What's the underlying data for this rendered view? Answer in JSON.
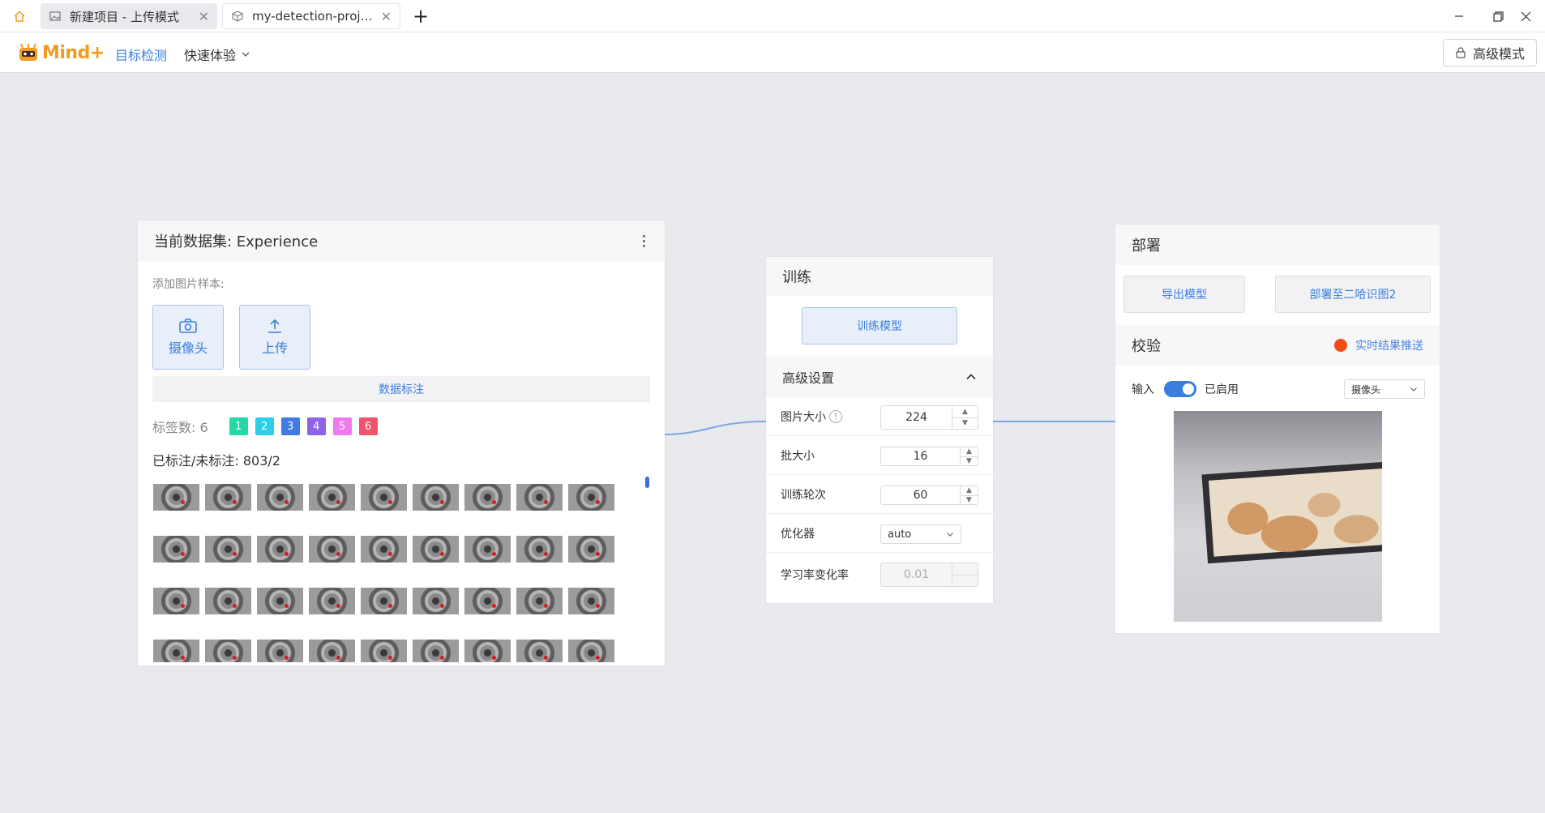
{
  "tabs": [
    {
      "label": "新建项目 - 上传模式"
    },
    {
      "label": "my-detection-proj…"
    }
  ],
  "app": {
    "logo_text": "Mind+"
  },
  "menu": {
    "active": "目标检测",
    "experience": "快速体验",
    "advanced_mode": "高级模式"
  },
  "dataset": {
    "title": "当前数据集: Experience",
    "add_samples_label": "添加图片样本:",
    "camera_button": "摄像头",
    "upload_button": "上传",
    "annotate_button": "数据标注",
    "label_count_text": "标签数: 6",
    "labels": [
      {
        "text": "1",
        "color": "#24d8a7"
      },
      {
        "text": "2",
        "color": "#2ad0e8"
      },
      {
        "text": "3",
        "color": "#3f7be3"
      },
      {
        "text": "4",
        "color": "#8e63e6"
      },
      {
        "text": "5",
        "color": "#ef79ef"
      },
      {
        "text": "6",
        "color": "#f0546c"
      }
    ],
    "annotated_text": "已标注/未标注: 803/2"
  },
  "train": {
    "title": "训练",
    "train_button": "训练模型",
    "advanced_title": "高级设置",
    "params": [
      {
        "label": "图片大小",
        "value": "224"
      },
      {
        "label": "批大小",
        "value": "16"
      },
      {
        "label": "训练轮次",
        "value": "60"
      },
      {
        "label": "优化器",
        "value": "auto"
      },
      {
        "label": "学习率变化率",
        "value": "0.01"
      }
    ]
  },
  "deploy": {
    "title": "部署",
    "export_button": "导出模型",
    "deploy_button": "部署至二哈识图2",
    "validate_title": "校验",
    "live_push": "实时结果推送",
    "input_label": "输入",
    "enabled_label": "已启用",
    "source_select": "摄像头"
  },
  "colors": {
    "accent": "#3a7ee0",
    "brand": "#f39a20",
    "live_dot": "#f34b15"
  }
}
